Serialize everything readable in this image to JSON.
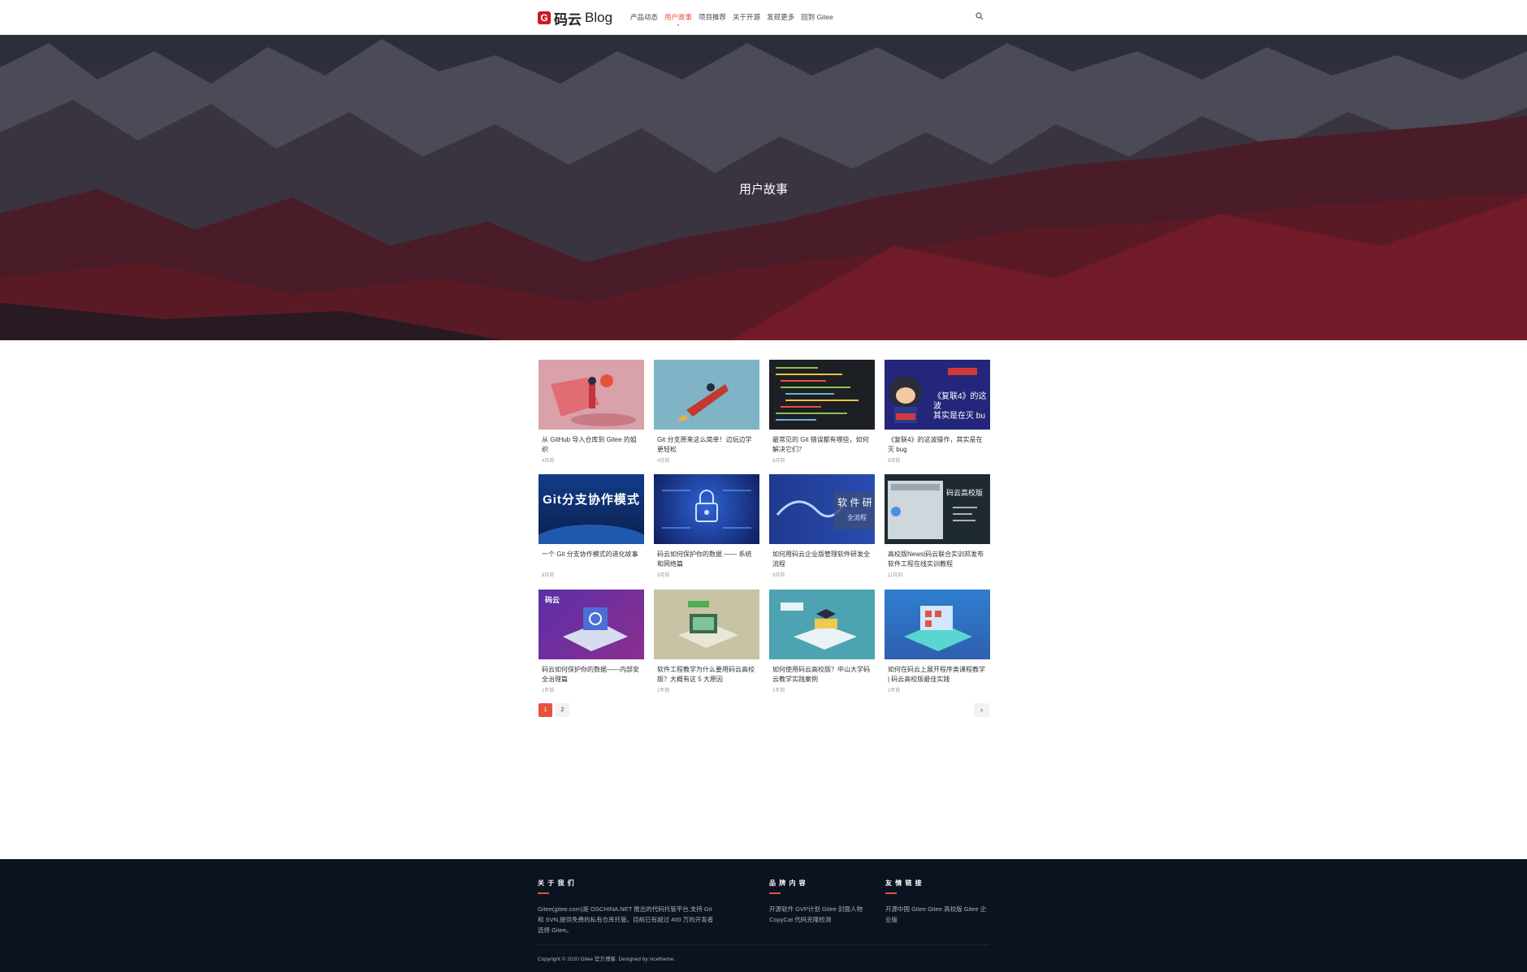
{
  "header": {
    "logo_cn": "码云",
    "logo_en": "Blog",
    "nav": [
      "产品动态",
      "用户故事",
      "项目推荐",
      "关于开源",
      "发现更多",
      "回到 Gitee"
    ],
    "active_nav": "用户故事",
    "search_icon": "search-icon"
  },
  "hero": {
    "title": "用户故事"
  },
  "posts": [
    {
      "title": "从 GitHub 导入仓库到 Gitee 的姐织",
      "date": "4月前"
    },
    {
      "title": "Git 分支原来这么简单！边玩边学更轻松",
      "date": "4月前"
    },
    {
      "title": "最常见的 Git 错误都有哪些，如何解决它们？",
      "date": "6月前"
    },
    {
      "title": "《复联4》的这波操作，其实是在灭 bug",
      "date": "9月前"
    },
    {
      "title": "一个 Git 分支协作模式的进化故事",
      "date": "9月前"
    },
    {
      "title": "码云如何保护你的数据 —— 系统和网络篇",
      "date": "9月前"
    },
    {
      "title": "如何用码云企业版管理软件研发全流程",
      "date": "9月前"
    },
    {
      "title": "高校版News|码云联合实训邦发布软件工程在线实训教程",
      "date": "11月前"
    },
    {
      "title": "码云如何保护你的数据——内部安全治理篇",
      "date": "1年前"
    },
    {
      "title": "软件工程教学为什么要用码云高校版？大概有这 5 大原因",
      "date": "1年前"
    },
    {
      "title": "如何使用码云高校版？中山大学码云教学实践案例",
      "date": "1年前"
    },
    {
      "title": "如何在码云上展开程序类课程教学 | 码云高校版最佳实践",
      "date": "1年前"
    }
  ],
  "thumb_text": {
    "t4_a": "《复联4》的这波",
    "t4_b": "其实是在灭 bu",
    "t5": "Git分支协作模式",
    "t7_a": "软 件 研",
    "t7_b": "全流程",
    "t8": "码云高校版",
    "t9": "码云"
  },
  "pagination": {
    "pages": [
      "1",
      "2"
    ],
    "active": "1",
    "next": "›"
  },
  "footer": {
    "about_title": "关 于 我 们",
    "about_text": "Gitee(gitee.com)是 OSCHINA.NET 推出的代码托管平台,支持 Git 和 SVN,提供免费的私有仓库托管。目前已有超过 400 万的开发者选择 Gitee。",
    "brand_title": "品 牌 内 容",
    "brand_links": "开源软件  GVP计划  Gitee 封面人物  CopyCat 代码克隆检测",
    "friend_title": "友 情 链 接",
    "friend_links": "开源中国  Gitee  Gitee 高校版  Gitee 企业版",
    "copyright": "Copyright © 2020 Gitee 官方博客. Designed by nicetheme."
  },
  "colors": {
    "accent": "#e5533c",
    "footer_bg": "#0b1220"
  }
}
